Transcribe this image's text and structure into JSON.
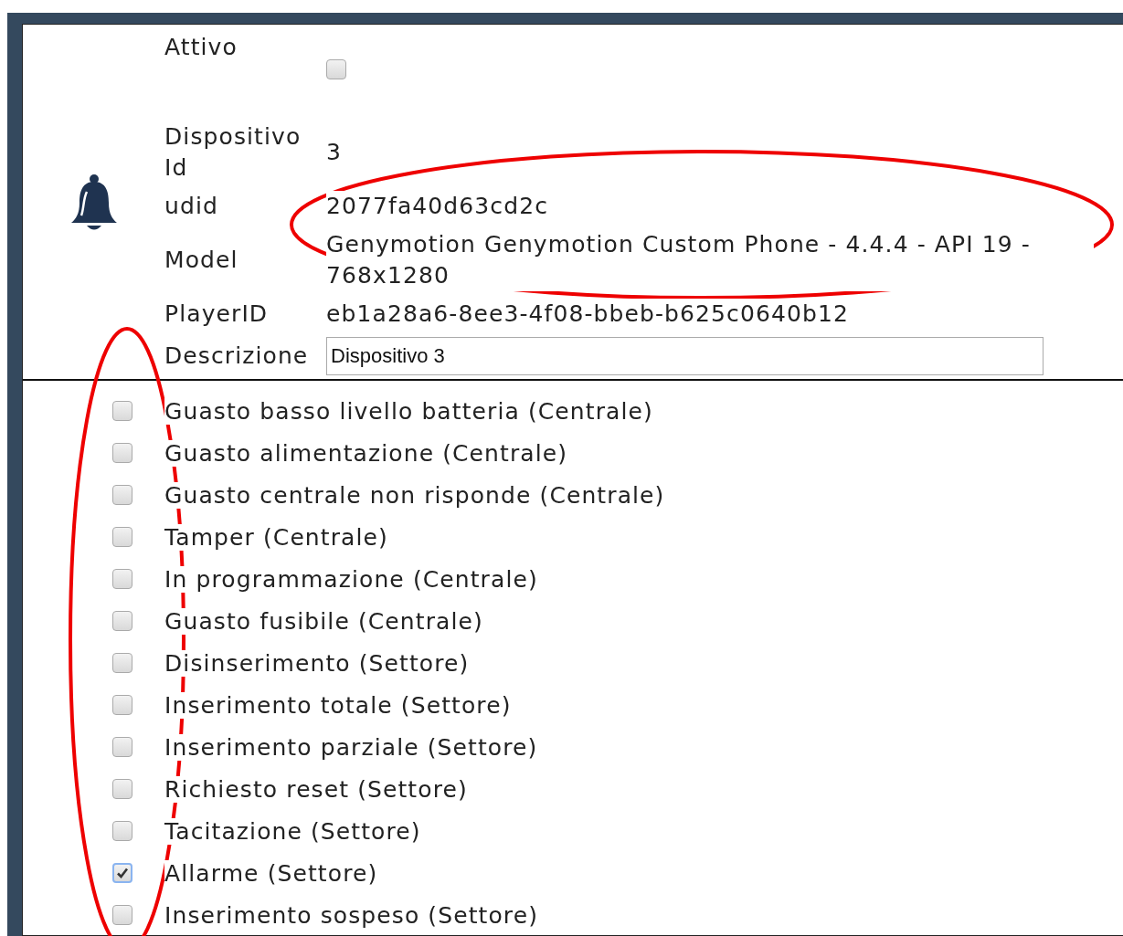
{
  "fields": [
    {
      "kind": "checkbox",
      "label": "Attivo",
      "checked": false
    },
    {
      "kind": "text",
      "label": "Dispositivo Id",
      "value": "3"
    },
    {
      "kind": "text",
      "label": "udid",
      "value": "2077fa40d63cd2c"
    },
    {
      "kind": "text",
      "label": "Model",
      "value": "Genymotion Genymotion Custom Phone - 4.4.4 - API 19 - 768x1280"
    },
    {
      "kind": "text",
      "label": "PlayerID",
      "value": "eb1a28a6-8ee3-4f08-bbeb-b625c0640b12"
    },
    {
      "kind": "input",
      "label": "Descrizione",
      "value": "Dispositivo 3"
    }
  ],
  "notifications": [
    {
      "label": "Guasto basso livello batteria (Centrale)",
      "checked": false
    },
    {
      "label": "Guasto alimentazione (Centrale)",
      "checked": false
    },
    {
      "label": "Guasto centrale non risponde (Centrale)",
      "checked": false
    },
    {
      "label": "Tamper (Centrale)",
      "checked": false
    },
    {
      "label": "In programmazione (Centrale)",
      "checked": false
    },
    {
      "label": "Guasto fusibile (Centrale)",
      "checked": false
    },
    {
      "label": "Disinserimento (Settore)",
      "checked": false
    },
    {
      "label": "Inserimento totale (Settore)",
      "checked": false
    },
    {
      "label": "Inserimento parziale (Settore)",
      "checked": false
    },
    {
      "label": "Richiesto reset (Settore)",
      "checked": false
    },
    {
      "label": "Tacitazione (Settore)",
      "checked": false
    },
    {
      "label": "Allarme (Settore)",
      "checked": true
    },
    {
      "label": "Inserimento sospeso (Settore)",
      "checked": false
    }
  ]
}
